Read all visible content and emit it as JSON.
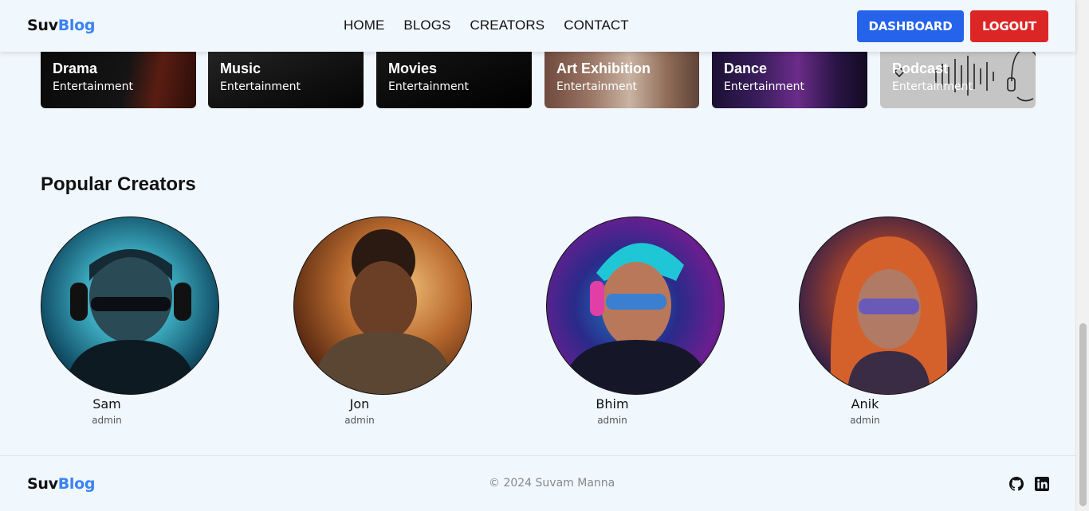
{
  "brand": {
    "prefix": "Suv",
    "suffix": "Blog"
  },
  "nav": {
    "links": [
      "HOME",
      "BLOGS",
      "CREATORS",
      "CONTACT"
    ],
    "dashboard_label": "DASHBOARD",
    "logout_label": "LOGOUT"
  },
  "categories": [
    {
      "name": "Drama",
      "category": "Entertainment"
    },
    {
      "name": "Music",
      "category": "Entertainment"
    },
    {
      "name": "Movies",
      "category": "Entertainment"
    },
    {
      "name": "Art Exhibition",
      "category": "Entertainment"
    },
    {
      "name": "Dance",
      "category": "Entertainment"
    },
    {
      "name": "Podcast",
      "category": "Entertainment"
    }
  ],
  "creators_section": {
    "title": "Popular Creators",
    "creators": [
      {
        "name": "Sam",
        "role": "admin"
      },
      {
        "name": "Jon",
        "role": "admin"
      },
      {
        "name": "Bhim",
        "role": "admin"
      },
      {
        "name": "Anik",
        "role": "admin"
      }
    ]
  },
  "footer": {
    "copyright": "© 2024 Suvam Manna",
    "icons": [
      "github-icon",
      "linkedin-icon"
    ]
  },
  "colors": {
    "accent_blue": "#2563eb",
    "logout_red": "#dc2626",
    "logo_blue": "#3b82f6",
    "page_bg": "#f0f7fd"
  }
}
